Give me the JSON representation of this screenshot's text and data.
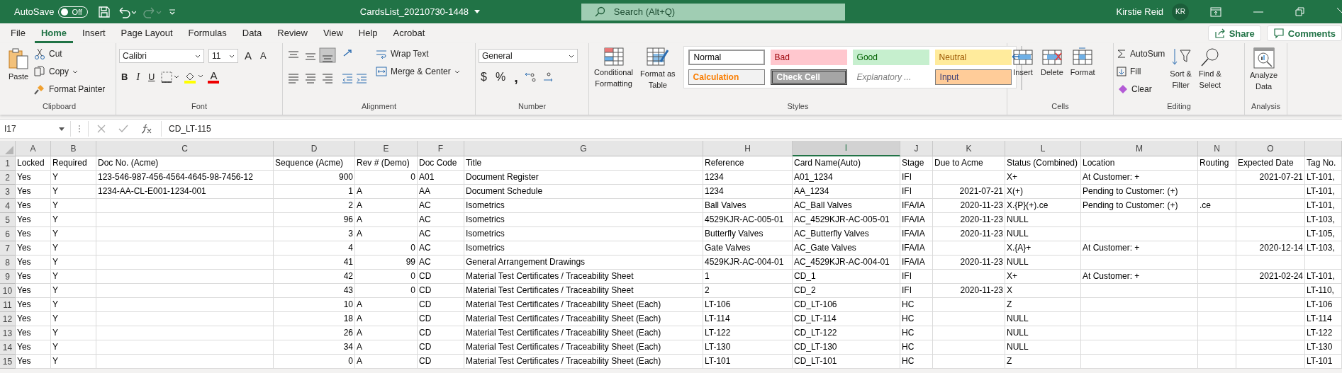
{
  "title_bar": {
    "autosave_label": "AutoSave",
    "autosave": {
      "on": false,
      "label": "Off"
    },
    "file_name": "CardsList_20210730-1448",
    "search": {
      "placeholder": "Search (Alt+Q)"
    },
    "user_name": "Kirstie Reid",
    "user_initials": "KR"
  },
  "tabs": [
    {
      "label": "File",
      "selected": false
    },
    {
      "label": "Home",
      "selected": true
    },
    {
      "label": "Insert",
      "selected": false
    },
    {
      "label": "Page Layout",
      "selected": false
    },
    {
      "label": "Formulas",
      "selected": false
    },
    {
      "label": "Data",
      "selected": false
    },
    {
      "label": "Review",
      "selected": false
    },
    {
      "label": "View",
      "selected": false
    },
    {
      "label": "Help",
      "selected": false
    },
    {
      "label": "Acrobat",
      "selected": false
    }
  ],
  "share": "Share",
  "comments": "Comments",
  "ribbon": {
    "clipboard": {
      "label": "Clipboard",
      "paste": "Paste",
      "cut": "Cut",
      "copy": "Copy",
      "format_painter": "Format Painter"
    },
    "font": {
      "label": "Font",
      "name": "Calibri",
      "size": "11",
      "grow": "A",
      "shrink": "A",
      "bold": "B",
      "italic": "I",
      "underline": "U",
      "font_color": "A"
    },
    "alignment": {
      "label": "Alignment",
      "wrap_text": "Wrap Text",
      "merge_center": "Merge & Center"
    },
    "number": {
      "label": "Number",
      "format": "General",
      "currency": "$",
      "percent": "%",
      "comma": ","
    },
    "styles": {
      "label": "Styles",
      "conditional": [
        "Conditional",
        "Formatting"
      ],
      "format_table": [
        "Format as",
        "Table"
      ],
      "gallery": [
        {
          "label": "Normal",
          "kind": "normal"
        },
        {
          "label": "Bad",
          "kind": "bad"
        },
        {
          "label": "Good",
          "kind": "good"
        },
        {
          "label": "Neutral",
          "kind": "neutral"
        },
        {
          "label": "Calculation",
          "kind": "calculation"
        },
        {
          "label": "Check Cell",
          "kind": "check"
        },
        {
          "label": "Explanatory ...",
          "kind": "explanatory"
        },
        {
          "label": "Input",
          "kind": "input"
        }
      ]
    },
    "cells": {
      "label": "Cells",
      "insert": "Insert",
      "delete": "Delete",
      "format": "Format"
    },
    "editing": {
      "label": "Editing",
      "autosum": "AutoSum",
      "fill": "Fill",
      "clear": "Clear",
      "sort": [
        "Sort &",
        "Filter"
      ],
      "find": [
        "Find &",
        "Select"
      ]
    },
    "analysis": {
      "label": "Analysis",
      "analyze": [
        "Analyze",
        "Data"
      ]
    }
  },
  "formula_bar": {
    "name_box": "I17",
    "formula": "CD_LT-115"
  },
  "columns": [
    {
      "letter": "A",
      "kind": "text",
      "selected": false
    },
    {
      "letter": "B",
      "kind": "text",
      "selected": false
    },
    {
      "letter": "C",
      "kind": "text",
      "selected": false
    },
    {
      "letter": "D",
      "kind": "number",
      "selected": false
    },
    {
      "letter": "E",
      "kind": "mixed",
      "selected": false
    },
    {
      "letter": "F",
      "kind": "text",
      "selected": false
    },
    {
      "letter": "G",
      "kind": "text",
      "selected": false
    },
    {
      "letter": "H",
      "kind": "text",
      "selected": false
    },
    {
      "letter": "I",
      "kind": "text",
      "selected": true
    },
    {
      "letter": "J",
      "kind": "text",
      "selected": false
    },
    {
      "letter": "K",
      "kind": "number",
      "selected": false
    },
    {
      "letter": "L",
      "kind": "text",
      "selected": false
    },
    {
      "letter": "M",
      "kind": "text",
      "selected": false
    },
    {
      "letter": "N",
      "kind": "text",
      "selected": false
    },
    {
      "letter": "O",
      "kind": "number",
      "selected": false
    },
    {
      "kind": "text",
      "selected": false
    }
  ],
  "rows": [
    {
      "number": "1",
      "kind": "header",
      "cells": [
        "Locked",
        "Required",
        "Doc No. (Acme)",
        "Sequence (Acme)",
        "Rev # (Demo)",
        "Doc Code",
        "Title",
        "Reference",
        "Card Name(Auto)",
        "Stage",
        "Due to Acme",
        "Status (Combined)",
        "Location",
        "Routing",
        "Expected Date",
        "Tag No."
      ]
    },
    {
      "number": "2",
      "kind": "data",
      "cells": [
        "Yes",
        "Y",
        "123-546-987-456-4564-4645-98-7456-12",
        "900",
        "0",
        "A01",
        "Document Register",
        "1234",
        "A01_1234",
        "IFI",
        null,
        "X+",
        "At Customer: +",
        null,
        "2021-07-21",
        "LT-101,"
      ]
    },
    {
      "number": "3",
      "kind": "data",
      "cells": [
        "Yes",
        "Y",
        "1234-AA-CL-E001-1234-001",
        "1",
        "A",
        "AA",
        "Document Schedule",
        "1234",
        "AA_1234",
        "IFI",
        "2021-07-21",
        "X(+)",
        "Pending to Customer: (+)",
        null,
        null,
        "LT-101,"
      ]
    },
    {
      "number": "4",
      "kind": "data",
      "cells": [
        "Yes",
        "Y",
        null,
        "2",
        "A",
        "AC",
        "Isometrics",
        "Ball Valves",
        "AC_Ball Valves",
        "IFA/IA",
        "2020-11-23",
        "X.{P}(+).ce",
        "Pending to Customer: (+)",
        ".ce",
        null,
        "LT-101,"
      ]
    },
    {
      "number": "5",
      "kind": "data",
      "cells": [
        "Yes",
        "Y",
        null,
        "96",
        "A",
        "AC",
        "Isometrics",
        "4529KJR-AC-005-01",
        "AC_4529KJR-AC-005-01",
        "IFA/IA",
        "2020-11-23",
        "NULL",
        null,
        null,
        null,
        "LT-103,"
      ]
    },
    {
      "number": "6",
      "kind": "data",
      "cells": [
        "Yes",
        "Y",
        null,
        "3",
        "A",
        "AC",
        "Isometrics",
        "Butterfly Valves",
        "AC_Butterfly Valves",
        "IFA/IA",
        "2020-11-23",
        "NULL",
        null,
        null,
        null,
        "LT-105,"
      ]
    },
    {
      "number": "7",
      "kind": "data",
      "cells": [
        "Yes",
        "Y",
        null,
        "4",
        "0",
        "AC",
        "Isometrics",
        "Gate Valves",
        "AC_Gate Valves",
        "IFA/IA",
        null,
        "X.{A}+",
        "At Customer: +",
        null,
        "2020-12-14",
        "LT-103,"
      ]
    },
    {
      "number": "8",
      "kind": "data",
      "cells": [
        "Yes",
        "Y",
        null,
        "41",
        "99",
        "AC",
        "General Arrangement Drawings",
        "4529KJR-AC-004-01",
        "AC_4529KJR-AC-004-01",
        "IFA/IA",
        "2020-11-23",
        "NULL",
        null,
        null,
        null,
        null
      ]
    },
    {
      "number": "9",
      "kind": "data",
      "cells": [
        "Yes",
        "Y",
        null,
        "42",
        "0",
        "CD",
        "Material Test Certificates / Traceability Sheet",
        "1",
        "CD_1",
        "IFI",
        null,
        "X+",
        "At Customer: +",
        null,
        "2021-02-24",
        "LT-101,"
      ]
    },
    {
      "number": "10",
      "kind": "data",
      "cells": [
        "Yes",
        "Y",
        null,
        "43",
        "0",
        "CD",
        "Material Test Certificates / Traceability Sheet",
        "2",
        "CD_2",
        "IFI",
        "2020-11-23",
        "X",
        null,
        null,
        null,
        "LT-110,"
      ]
    },
    {
      "number": "11",
      "kind": "data",
      "cells": [
        "Yes",
        "Y",
        null,
        "10",
        "A",
        "CD",
        "Material Test Certificates / Traceability Sheet (Each)",
        "LT-106",
        "CD_LT-106",
        "HC",
        null,
        "Z",
        null,
        null,
        null,
        "LT-106"
      ]
    },
    {
      "number": "12",
      "kind": "data",
      "cells": [
        "Yes",
        "Y",
        null,
        "18",
        "A",
        "CD",
        "Material Test Certificates / Traceability Sheet (Each)",
        "LT-114",
        "CD_LT-114",
        "HC",
        null,
        "NULL",
        null,
        null,
        null,
        "LT-114"
      ]
    },
    {
      "number": "13",
      "kind": "data",
      "cells": [
        "Yes",
        "Y",
        null,
        "26",
        "A",
        "CD",
        "Material Test Certificates / Traceability Sheet (Each)",
        "LT-122",
        "CD_LT-122",
        "HC",
        null,
        "NULL",
        null,
        null,
        null,
        "LT-122"
      ]
    },
    {
      "number": "14",
      "kind": "data",
      "cells": [
        "Yes",
        "Y",
        null,
        "34",
        "A",
        "CD",
        "Material Test Certificates / Traceability Sheet (Each)",
        "LT-130",
        "CD_LT-130",
        "HC",
        null,
        "NULL",
        null,
        null,
        null,
        "LT-130"
      ]
    },
    {
      "number": "15",
      "kind": "data",
      "cells": [
        "Yes",
        "Y",
        null,
        "0",
        "A",
        "CD",
        "Material Test Certificates / Traceability Sheet (Each)",
        "LT-101",
        "CD_LT-101",
        "HC",
        null,
        "Z",
        null,
        null,
        null,
        "LT-101"
      ]
    }
  ]
}
